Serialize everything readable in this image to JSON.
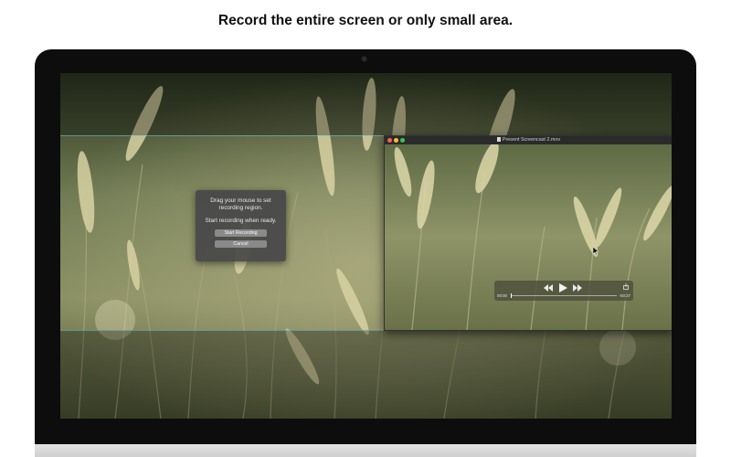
{
  "headline": "Record the entire screen or only small area.",
  "dialog": {
    "message_line1": "Drag your mouse to set",
    "message_line2": "recording region.",
    "message_line3": "Start recording when ready.",
    "start_label": "Start Recording",
    "cancel_label": "Cancel"
  },
  "player": {
    "title": "Present Screencast 2.mov",
    "elapsed": "00:00",
    "remaining": "-00:37",
    "progress": 0.0,
    "icons": {
      "rewind": "rewind-icon",
      "play": "play-icon",
      "fast_forward": "fast-forward-icon",
      "share": "share-icon"
    }
  },
  "colors": {
    "dialog_bg": "#464648",
    "button_bg": "#8a8a8c",
    "region_line": "#6ec8d2",
    "traffic_close": "#fc605c",
    "traffic_minimize": "#fdbc40",
    "traffic_zoom": "#34c84a"
  }
}
